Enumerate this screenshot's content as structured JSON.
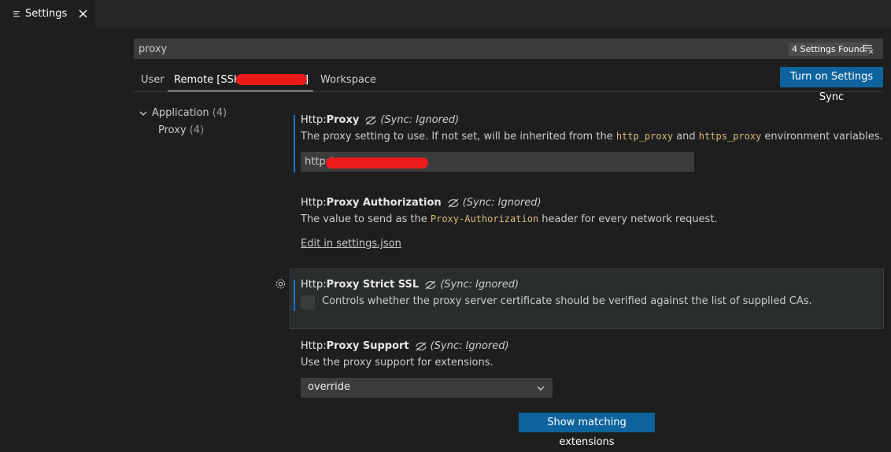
{
  "tab": {
    "label": "Settings"
  },
  "search": {
    "value": "proxy",
    "results_badge": "4 Settings Found"
  },
  "scopes": {
    "user": "User",
    "remote": "Remote [SSH:",
    "remote_suffix": "]",
    "workspace": "Workspace"
  },
  "sync_button": "Turn on Settings Sync",
  "toc": {
    "group": "Application",
    "group_count": "(4)",
    "item": "Proxy",
    "item_count": "(4)"
  },
  "sync_ignored_label": "Sync: Ignored",
  "settings": {
    "proxy": {
      "category": "Http: ",
      "name": "Proxy",
      "desc_prefix": "The proxy setting to use. If not set, will be inherited from the ",
      "code1": "http_proxy",
      "desc_and": " and ",
      "code2": "https_proxy",
      "desc_suffix": " environment variables.",
      "value": "http:/"
    },
    "auth": {
      "category": "Http: ",
      "name": "Proxy Authorization",
      "desc_prefix": "The value to send as the ",
      "code": "Proxy-Authorization",
      "desc_suffix": " header for every network request.",
      "link": "Edit in settings.json"
    },
    "strict_ssl": {
      "category": "Http: ",
      "name": "Proxy Strict SSL",
      "desc": "Controls whether the proxy server certificate should be verified against the list of supplied CAs.",
      "checked": false
    },
    "support": {
      "category": "Http: ",
      "name": "Proxy Support",
      "desc": "Use the proxy support for extensions.",
      "selected": "override"
    }
  },
  "extensions_button": "Show matching extensions",
  "colors": {
    "accent": "#0078d4",
    "button": "#0e639c",
    "redaction": "#ec1b1b",
    "code": "#d7ba7d"
  },
  "icons": {
    "tab": "settings-list-icon",
    "close": "close-icon",
    "filter": "clear-filter-icon",
    "chevron": "chevron-down-icon",
    "sync": "sync-ignored-icon",
    "gear": "gear-icon"
  }
}
